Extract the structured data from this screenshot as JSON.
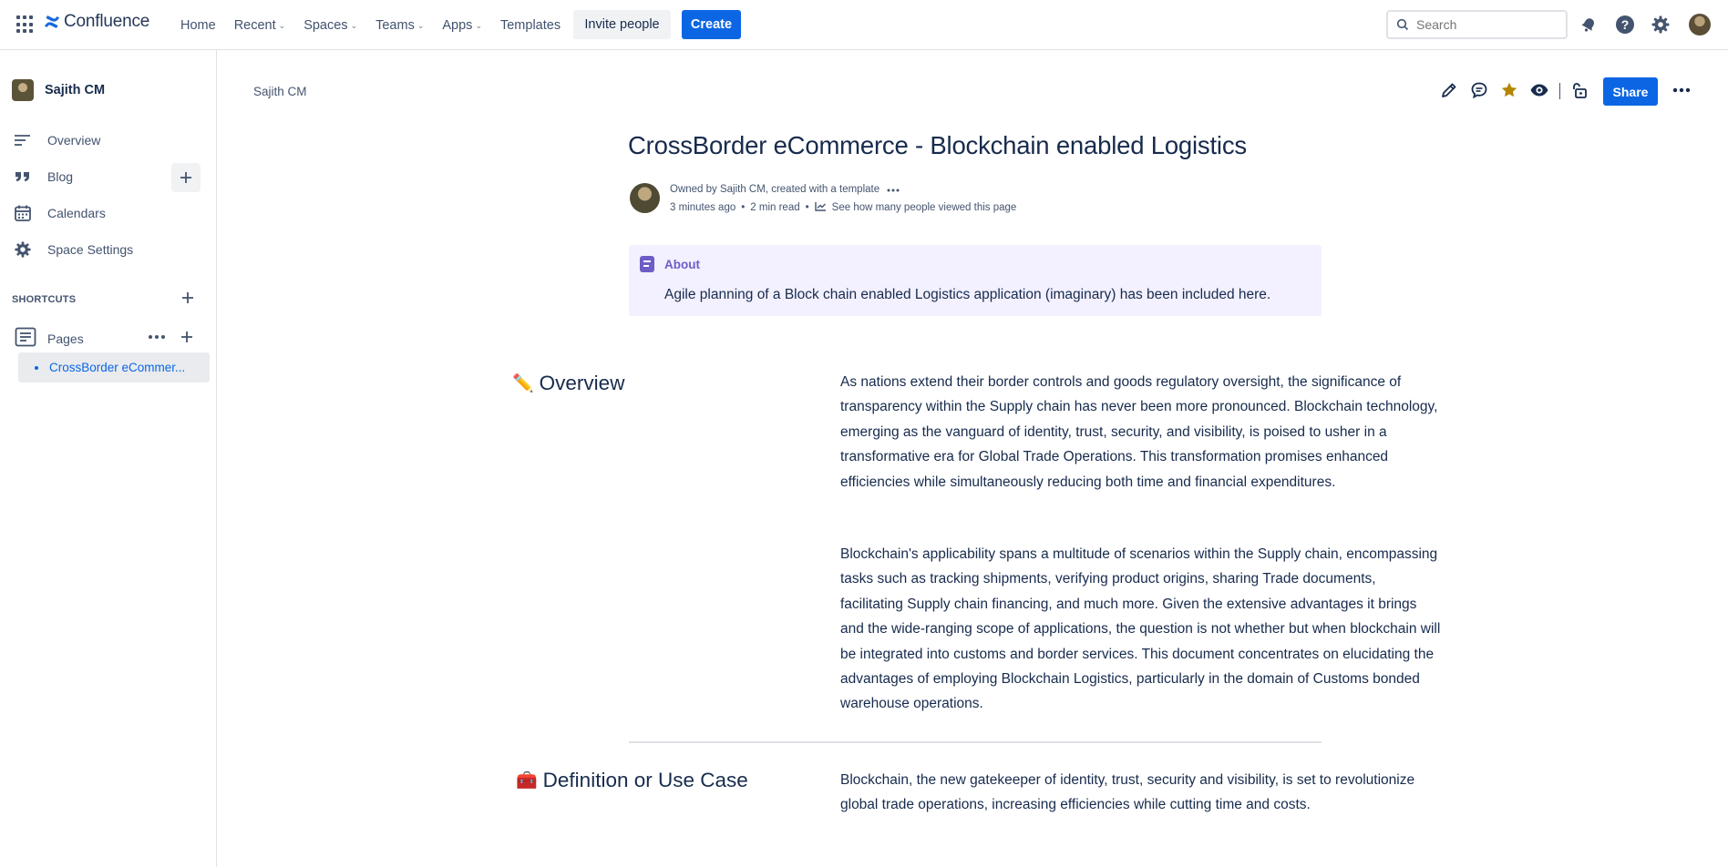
{
  "app": {
    "name": "Confluence"
  },
  "topnav": {
    "items": [
      {
        "label": "Home",
        "has_chevron": false
      },
      {
        "label": "Recent",
        "has_chevron": true
      },
      {
        "label": "Spaces",
        "has_chevron": true
      },
      {
        "label": "Teams",
        "has_chevron": true
      },
      {
        "label": "Apps",
        "has_chevron": true
      },
      {
        "label": "Templates",
        "has_chevron": false
      }
    ],
    "invite_label": "Invite people",
    "create_label": "Create",
    "search_placeholder": "Search",
    "icons": [
      "notifications-icon",
      "help-icon",
      "settings-icon",
      "profile-avatar"
    ]
  },
  "sidebar": {
    "space_name": "Sajith CM",
    "items": [
      {
        "label": "Overview",
        "icon": "overview-icon"
      },
      {
        "label": "Blog",
        "icon": "quote-icon"
      },
      {
        "label": "Calendars",
        "icon": "calendar-icon"
      },
      {
        "label": "Space Settings",
        "icon": "gear-icon"
      }
    ],
    "shortcuts_label": "SHORTCUTS",
    "pages_label": "Pages",
    "page_tree": [
      {
        "label": "CrossBorder eCommer...",
        "selected": true
      }
    ]
  },
  "page": {
    "breadcrumb": "Sajith CM",
    "share_label": "Share",
    "title": "CrossBorder eCommerce - Blockchain enabled Logistics",
    "byline": {
      "owned_by": "Owned by Sajith CM, created with a template",
      "time_ago": "3 minutes ago",
      "read_time": "2 min read",
      "analytics_link": "See how many people viewed this page"
    },
    "info_panel": {
      "title": "About",
      "text": "Agile planning of a Block chain enabled Logistics application (imaginary) has been included here.",
      "color": "#6e5dc6"
    },
    "sections": [
      {
        "emoji": "✏️",
        "heading": "Overview",
        "paragraphs": [
          "As nations extend their border controls and goods regulatory oversight, the significance of transparency within the Supply chain has never been more pronounced. Blockchain technology, emerging as the vanguard of identity, trust, security, and visibility, is poised to usher in a transformative era for Global Trade Operations. This transformation promises enhanced efficiencies while simultaneously reducing both time and financial expenditures.",
          "Blockchain's applicability spans a multitude of scenarios within the Supply chain, encompassing tasks such as tracking shipments, verifying product origins, sharing Trade documents, facilitating Supply chain financing, and much more. Given the extensive advantages it brings and the wide-ranging scope of applications, the question is not whether but when blockchain will be integrated into customs and border services. This document concentrates on elucidating the advantages of employing Blockchain Logistics, particularly in the domain of Customs bonded warehouse operations."
        ]
      },
      {
        "emoji": "🧰",
        "heading": "Definition or Use Case",
        "paragraphs": [
          "Blockchain, the new gatekeeper of identity, trust, security and visibility, is set to revolutionize global trade operations, increasing efficiencies while cutting time and costs."
        ]
      }
    ],
    "accent_color": "#0c66e4",
    "star_color": "#b38600"
  }
}
